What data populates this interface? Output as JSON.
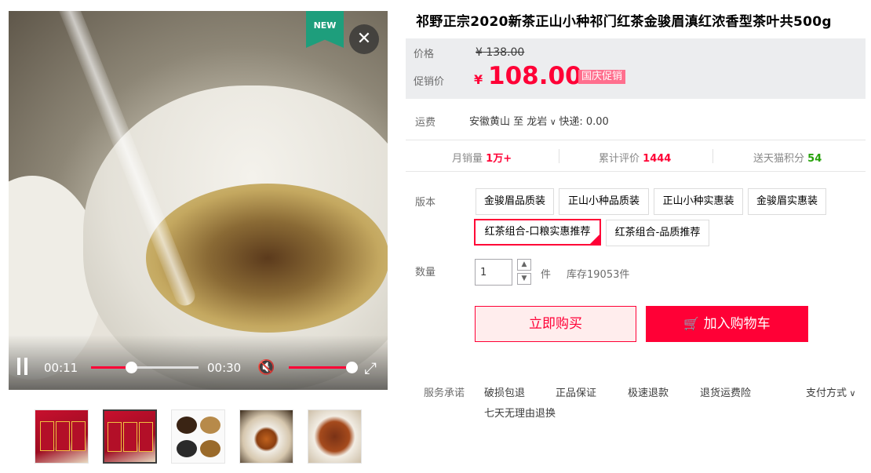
{
  "video": {
    "badge": "NEW",
    "close_glyph": "✕",
    "current_time": "00:11",
    "duration": "00:30",
    "progress_fraction": 0.37,
    "volume_fraction": 1.0
  },
  "thumbnails": [
    {
      "name": "product-box-photo"
    },
    {
      "name": "product-box-photo-2"
    },
    {
      "name": "tea-leaves-grid"
    },
    {
      "name": "tea-cup-brewed"
    },
    {
      "name": "tea-leaves-closeup"
    }
  ],
  "product": {
    "title": "祁野正宗2020新茶正山小种祁门红茶金骏眉滇红浓香型茶叶共500g",
    "price_label": "价格",
    "original_price": "¥ 138.00",
    "promo_label": "促销价",
    "currency": "¥",
    "promo_price": "108.00",
    "promo_tag": "国庆促销"
  },
  "shipping": {
    "label": "运费",
    "text": "安徽黄山  至 龙岩",
    "express": "快递: 0.00"
  },
  "stats": {
    "sales_label": "月销量",
    "sales_value": "1万+",
    "reviews_label": "累计评价",
    "reviews_value": "1444",
    "points_label": "送天猫积分",
    "points_value": "54"
  },
  "options": {
    "label": "版本",
    "items": [
      "金骏眉品质装",
      "正山小种品质装",
      "正山小种实惠装",
      "金骏眉实惠装",
      "红茶组合-口粮实惠推荐",
      "红茶组合-品质推荐"
    ],
    "selected": "红茶组合-口粮实惠推荐"
  },
  "quantity": {
    "label": "数量",
    "value": "1",
    "unit": "件",
    "stock": "库存19053件"
  },
  "actions": {
    "buy_now": "立即购买",
    "add_to_cart": "加入购物车"
  },
  "services": {
    "label": "服务承诺",
    "items": [
      "破损包退",
      "正品保证",
      "极速退款",
      "退货运费险"
    ],
    "extra": "七天无理由退换",
    "payment": "支付方式"
  },
  "colors": {
    "accent": "#ff0036",
    "new_badge": "#1e9e7c",
    "promo_tag": "#ff6f8e",
    "points": "#26a20a"
  }
}
